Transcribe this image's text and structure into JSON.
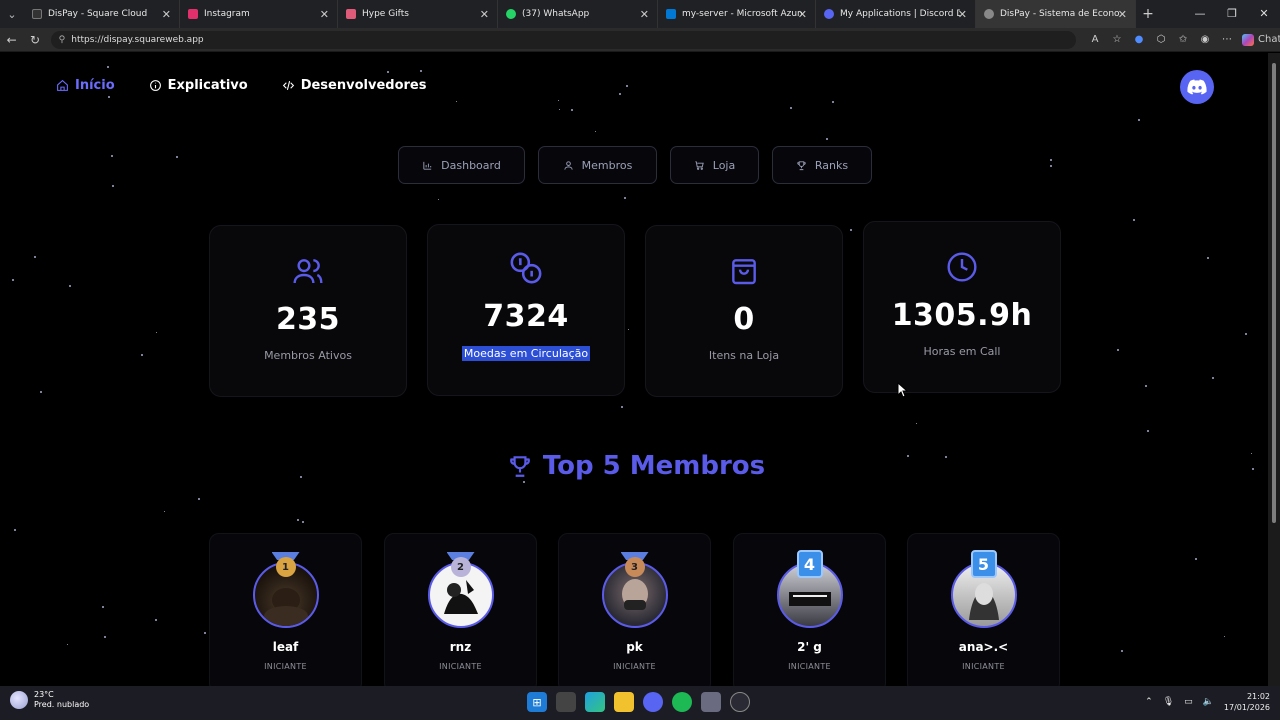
{
  "browser": {
    "tabs": [
      {
        "label": "DisPay - Square Cloud",
        "color": "#333"
      },
      {
        "label": "Instagram",
        "color": "#e1306c"
      },
      {
        "label": "Hype Gifts",
        "color": "#e05a7a"
      },
      {
        "label": "(37) WhatsApp",
        "color": "#25d366"
      },
      {
        "label": "my-server - Microsoft Azure",
        "color": "#0078d4"
      },
      {
        "label": "My Applications | Discord Develo",
        "color": "#5865f2"
      },
      {
        "label": "DisPay - Sistema de Economia Di",
        "color": "#888",
        "active": true
      }
    ],
    "url": "https://dispay.squareweb.app",
    "chat_label": "Chat"
  },
  "nav": {
    "items": [
      {
        "label": "Início",
        "icon": "home-icon",
        "active": true
      },
      {
        "label": "Explicativo",
        "icon": "info-icon"
      },
      {
        "label": "Desenvolvedores",
        "icon": "code-icon"
      }
    ]
  },
  "subnav": {
    "buttons": [
      {
        "label": "Dashboard",
        "icon": "bar-chart-icon"
      },
      {
        "label": "Membros",
        "icon": "user-icon"
      },
      {
        "label": "Loja",
        "icon": "cart-icon"
      },
      {
        "label": "Ranks",
        "icon": "trophy-icon"
      }
    ]
  },
  "stats": [
    {
      "value": "235",
      "label": "Membros Ativos",
      "icon": "users-icon"
    },
    {
      "value": "7324",
      "label": "Moedas em Circulação",
      "icon": "coins-icon",
      "selected": true
    },
    {
      "value": "0",
      "label": "Itens na Loja",
      "icon": "shopping-bag-icon"
    },
    {
      "value": "1305.9h",
      "label": "Horas em Call",
      "icon": "clock-icon"
    }
  ],
  "top": {
    "title": "Top 5 Membros",
    "members": [
      {
        "rank": "1",
        "name": "leaf",
        "tier": "INICIANTE",
        "medal": "#d9a441"
      },
      {
        "rank": "2",
        "name": "rnz",
        "tier": "INICIANTE",
        "medal": "#b9b3d9"
      },
      {
        "rank": "3",
        "name": "pk",
        "tier": "INICIANTE",
        "medal": "#c98a5a"
      },
      {
        "rank": "4",
        "name": "2' g",
        "tier": "INICIANTE"
      },
      {
        "rank": "5",
        "name": "ana>.<",
        "tier": "INICIANTE"
      }
    ]
  },
  "taskbar": {
    "weather_temp": "23°C",
    "weather_desc": "Pred. nublado",
    "time": "21:02",
    "date": "17/01/2026"
  },
  "colors": {
    "accent": "#5b5bea",
    "discord": "#5865f2",
    "selection": "#2c4fd6"
  }
}
